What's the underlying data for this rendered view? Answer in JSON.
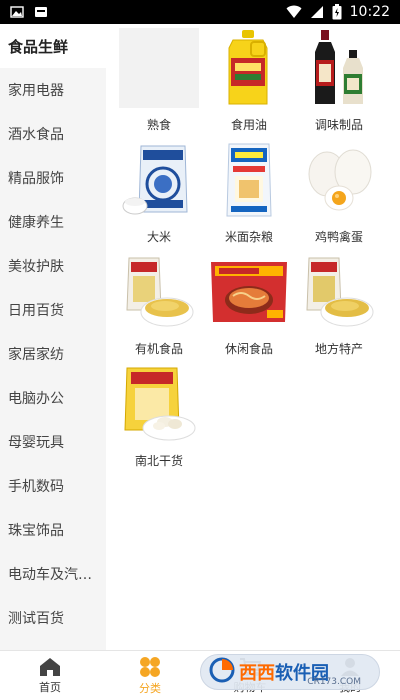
{
  "status_bar": {
    "time": "10:22"
  },
  "sidebar": {
    "items": [
      {
        "label": "食品生鲜",
        "active": true
      },
      {
        "label": "家用电器"
      },
      {
        "label": "酒水食品"
      },
      {
        "label": "精品服饰"
      },
      {
        "label": "健康养生"
      },
      {
        "label": "美妆护肤"
      },
      {
        "label": "日用百货"
      },
      {
        "label": "家居家纺"
      },
      {
        "label": "电脑办公"
      },
      {
        "label": "母婴玩具"
      },
      {
        "label": "手机数码"
      },
      {
        "label": "珠宝饰品"
      },
      {
        "label": "电动车及汽车..."
      },
      {
        "label": "测试百货"
      }
    ]
  },
  "grid": {
    "tiles": [
      {
        "label": "熟食",
        "icon": "cooked-food-placeholder"
      },
      {
        "label": "食用油",
        "icon": "cooking-oil-bottle"
      },
      {
        "label": "调味制品",
        "icon": "sauce-bottles"
      },
      {
        "label": "大米",
        "icon": "rice-bag"
      },
      {
        "label": "米面杂粮",
        "icon": "grain-bag"
      },
      {
        "label": "鸡鸭禽蛋",
        "icon": "eggs"
      },
      {
        "label": "有机食品",
        "icon": "millet-bag"
      },
      {
        "label": "休闲食品",
        "icon": "snack-bag"
      },
      {
        "label": "地方特产",
        "icon": "millet-bag-2"
      },
      {
        "label": "南北干货",
        "icon": "dried-goods-bag"
      }
    ]
  },
  "tabbar": {
    "tabs": [
      {
        "label": "首页",
        "icon": "home-icon"
      },
      {
        "label": "分类",
        "icon": "category-icon",
        "active": true
      },
      {
        "label": "购物车",
        "icon": "cart-icon"
      },
      {
        "label": "我的",
        "icon": "profile-icon"
      }
    ]
  },
  "watermark": {
    "text_a": "西西",
    "text_b": "软件园",
    "sub": "CR173.COM"
  },
  "colors": {
    "accent": "#f5a623",
    "sidebar_bg": "#f5f5f5",
    "status_bar_bg": "#000000"
  }
}
